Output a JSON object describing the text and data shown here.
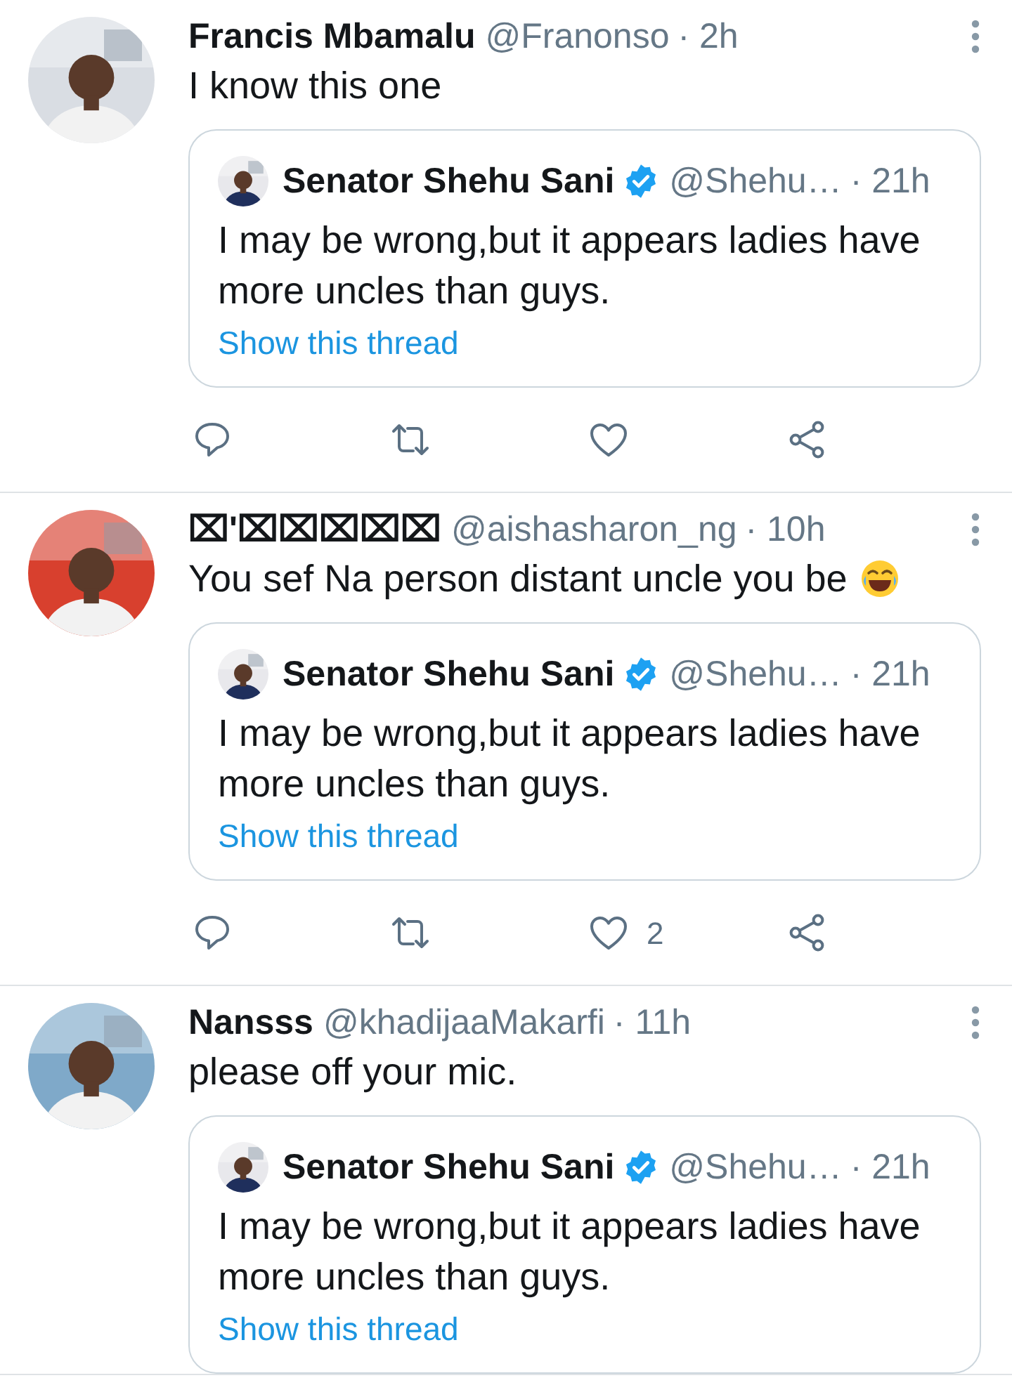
{
  "tweets": [
    {
      "name": "Francis Mbamalu",
      "handle": "@Franonso",
      "time": "· 2h",
      "text": "I know this one",
      "liked": false,
      "quote": {
        "name": "Senator Shehu Sani",
        "verified": true,
        "handle": "@Shehu…",
        "time": "· 21h",
        "text": "I may be wrong,but it appears ladies have more uncles than guys.",
        "link": "Show this thread"
      }
    },
    {
      "name": "⌧'⌧⌧⌧⌧⌧",
      "handle": "@aishasharon_ng",
      "time": "· 10h",
      "text": "You sef Na person distant uncle you be",
      "trailing_emoji": true,
      "liked": false,
      "like_count": "2",
      "quote": {
        "name": "Senator Shehu Sani",
        "verified": true,
        "handle": "@Shehu…",
        "time": "· 21h",
        "text": "I may be wrong,but it appears ladies have more uncles than guys.",
        "link": "Show this thread"
      }
    },
    {
      "name": "Nansss",
      "handle": "@khadijaaMakarfi",
      "time": "· 11h",
      "text": "please off your mic.",
      "quote": {
        "name": "Senator Shehu Sani",
        "verified": true,
        "handle": "@Shehu…",
        "time": "· 21h",
        "text": "I may be wrong,but it appears ladies have more uncles than guys.",
        "link": "Show this thread"
      }
    }
  ]
}
